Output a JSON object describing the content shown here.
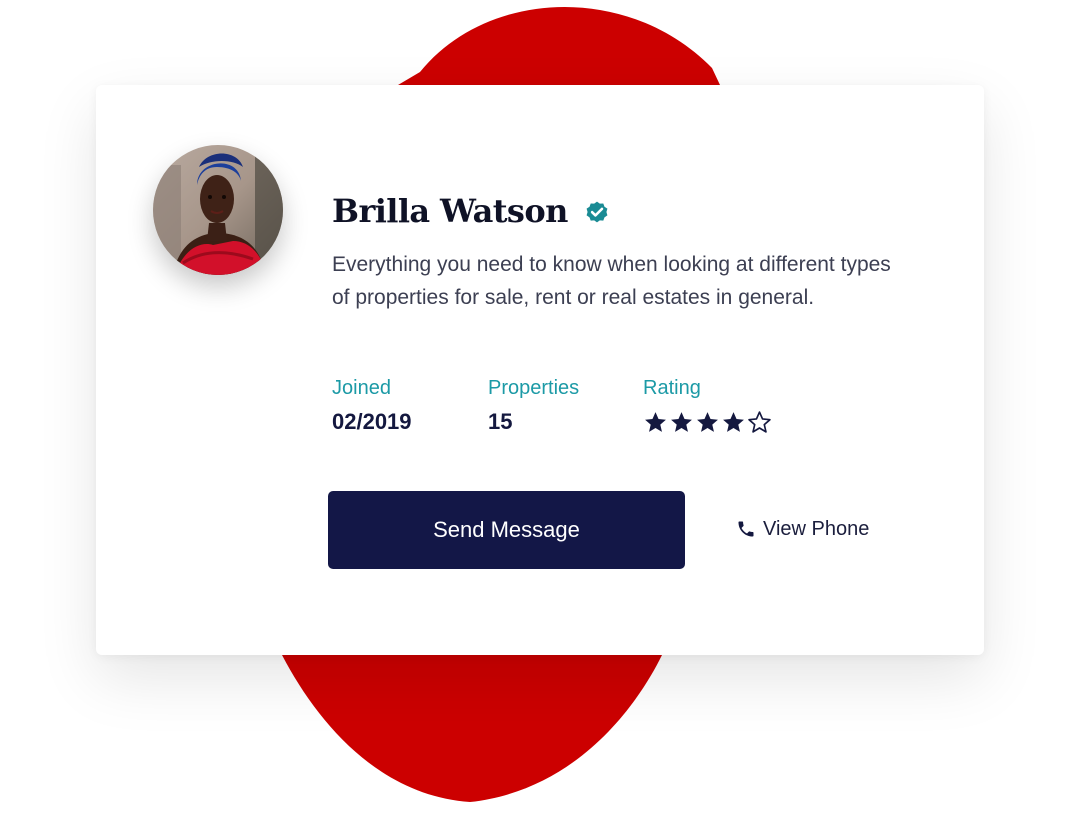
{
  "colors": {
    "accent_red": "#cc0000",
    "navy": "#131747",
    "teal": "#1c9aa6",
    "verified_badge": "#1a8b94",
    "text_body": "#3c3f52"
  },
  "profile": {
    "name": "Brilla Watson",
    "verified_icon": "verified-badge-icon",
    "avatar_icon": "profile-photo",
    "bio": "Everything you need to know when looking at different types of properties for sale, rent or real estates in general."
  },
  "stats": {
    "joined": {
      "label": "Joined",
      "value": "02/2019"
    },
    "properties": {
      "label": "Properties",
      "value": "15"
    },
    "rating": {
      "label": "Rating",
      "value": 4,
      "max": 5,
      "icon": "star-icon"
    }
  },
  "actions": {
    "send_message": "Send Message",
    "view_phone": "View Phone",
    "phone_icon": "phone-icon"
  }
}
